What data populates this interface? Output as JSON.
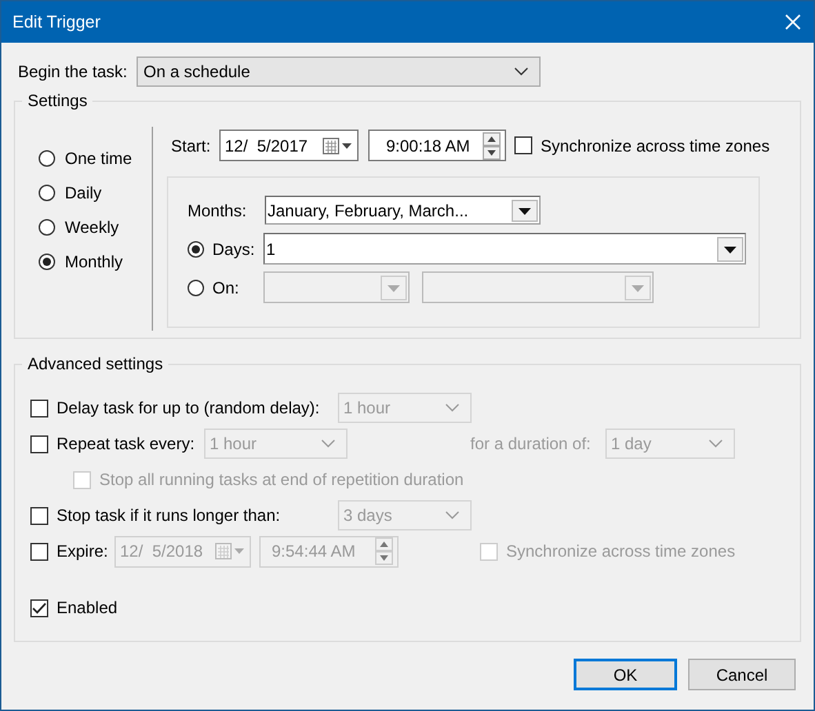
{
  "window": {
    "title": "Edit Trigger"
  },
  "begin_task": {
    "label": "Begin the task:",
    "value": "On a schedule"
  },
  "settings": {
    "title": "Settings",
    "schedule_options": [
      {
        "label": "One time",
        "selected": false
      },
      {
        "label": "Daily",
        "selected": false
      },
      {
        "label": "Weekly",
        "selected": false
      },
      {
        "label": "Monthly",
        "selected": true
      }
    ],
    "start": {
      "label": "Start:",
      "date": "12/  5/2017",
      "time": "9:00:18 AM",
      "sync": {
        "label": "Synchronize across time zones",
        "checked": false
      }
    },
    "months": {
      "label": "Months:",
      "value": "January, February, March..."
    },
    "days": {
      "label": "Days:",
      "value": "1",
      "selected": true
    },
    "on": {
      "label": "On:",
      "selected": false
    }
  },
  "advanced": {
    "title": "Advanced settings",
    "delay": {
      "label": "Delay task for up to (random delay):",
      "checked": false,
      "value": "1 hour"
    },
    "repeat": {
      "label": "Repeat task every:",
      "checked": false,
      "value": "1 hour",
      "duration_label": "for a duration of:",
      "duration_value": "1 day"
    },
    "stop_all": {
      "label": "Stop all running tasks at end of repetition duration",
      "checked": false,
      "disabled": true
    },
    "stop_long": {
      "label": "Stop task if it runs longer than:",
      "checked": false,
      "value": "3 days"
    },
    "expire": {
      "label": "Expire:",
      "checked": false,
      "date": "12/  5/2018",
      "time": "9:54:44 AM",
      "sync": {
        "label": "Synchronize across time zones",
        "checked": false,
        "disabled": true
      }
    },
    "enabled": {
      "label": "Enabled",
      "checked": true
    }
  },
  "buttons": [
    {
      "label": "OK",
      "focused": true
    },
    {
      "label": "Cancel",
      "focused": false
    }
  ]
}
